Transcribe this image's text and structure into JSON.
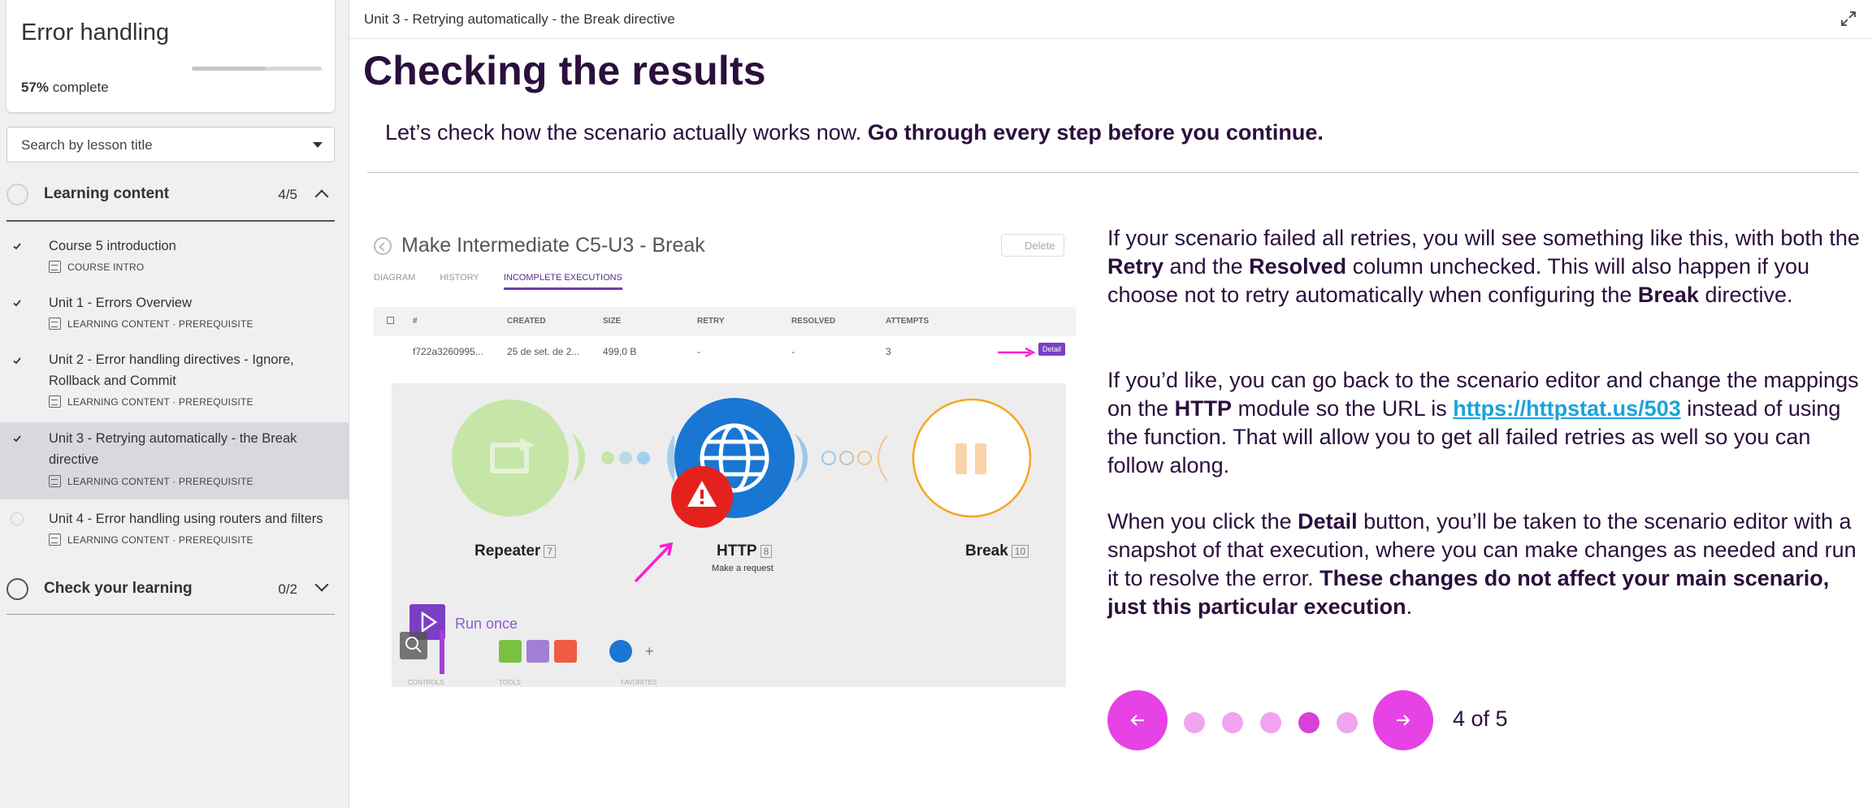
{
  "sidebar": {
    "course_title": "Error handling",
    "progress_percent": 57,
    "progress_value": "57%",
    "progress_suffix": " complete",
    "search_placeholder": "Search by lesson title",
    "sections": [
      {
        "label": "Learning content",
        "count": "4/5",
        "expanded": true
      },
      {
        "label": "Check your learning",
        "count": "0/2",
        "expanded": false
      }
    ],
    "lessons": [
      {
        "title": "Course 5 introduction",
        "meta": "COURSE INTRO",
        "completed": true
      },
      {
        "title": "Unit 1 - Errors Overview",
        "meta": "LEARNING CONTENT · PREREQUISITE",
        "completed": true
      },
      {
        "title": "Unit 2 - Error handling directives - Ignore, Rollback and Commit",
        "meta": "LEARNING CONTENT · PREREQUISITE",
        "completed": true
      },
      {
        "title": "Unit 3 - Retrying automatically - the Break directive",
        "meta": "LEARNING CONTENT · PREREQUISITE",
        "completed": true,
        "active": true
      },
      {
        "title": "Unit 4 - Error handling using routers and filters",
        "meta": "LEARNING CONTENT · PREREQUISITE",
        "completed": false
      }
    ]
  },
  "header": {
    "unit_title": "Unit 3 - Retrying automatically - the Break directive"
  },
  "main": {
    "heading": "Checking the results",
    "intro_plain": "Let’s check how the scenario actually works now. ",
    "intro_bold": "Go through every step before you continue.",
    "p1": {
      "a": "If your scenario failed all retries, you will see something like this, with both the ",
      "b1": "Retry",
      "c": " and the ",
      "b2": "Resolved",
      "d": " column unchecked. This will also happen if you choose not to retry automatically when configuring the ",
      "b3": "Break",
      "e": " directive."
    },
    "p2": {
      "a": "If you’d like, you can go back to the scenario editor and change the mappings on the ",
      "b1": "HTTP",
      "c": " module so the URL is ",
      "link": "https://httpstat.us/503",
      "d": " instead of using the function. That will allow you to get all failed retries as well so you can follow along."
    },
    "p3": {
      "a": "When you click the ",
      "b1": "Detail",
      "c": " button, you’ll be taken to the scenario editor with a snapshot of that execution, where you can make changes as needed and run it to resolve the error. ",
      "b2": "These changes do not affect your main scenario, just this particular execution",
      "d": "."
    }
  },
  "illustration": {
    "scenario_title": "Make Intermediate C5-U3 - Break",
    "delete_label": "Delete",
    "tabs": [
      "DIAGRAM",
      "HISTORY",
      "INCOMPLETE EXECUTIONS"
    ],
    "columns": [
      "#",
      "CREATED",
      "SIZE",
      "RETRY",
      "RESOLVED",
      "ATTEMPTS"
    ],
    "row": [
      "f722a3260995...",
      "25 de set. de 2...",
      "499,0 B",
      "-",
      "-",
      "3"
    ],
    "detail_label": "Detail",
    "modules": [
      {
        "name": "Repeater",
        "num": "7"
      },
      {
        "name": "HTTP",
        "num": "8",
        "sub": "Make a request"
      },
      {
        "name": "Break",
        "num": "10"
      }
    ],
    "run_once": "Run once",
    "toolbar_labels": [
      "CONTROLS",
      "TOOLS",
      "FAVORITES"
    ]
  },
  "pager": {
    "current": 4,
    "total": 5,
    "label": "4 of 5"
  },
  "colors": {
    "heading": "#2b0f3d",
    "accent": "#e642e6",
    "link": "#1aa3d9",
    "repeater": "#9fd46a",
    "http": "#1976d2",
    "break": "#f5a623",
    "error": "#e5211e"
  }
}
